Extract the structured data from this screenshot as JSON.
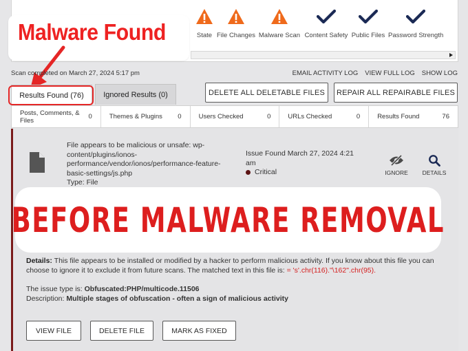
{
  "scan_stages": [
    {
      "label": "State",
      "status": "warning"
    },
    {
      "label": "File Changes",
      "status": "warning"
    },
    {
      "label": "Malware Scan",
      "status": "warning"
    },
    {
      "label": "Content Safety",
      "status": "ok"
    },
    {
      "label": "Public Files",
      "status": "ok"
    },
    {
      "label": "Password Strength",
      "status": "ok"
    }
  ],
  "callout": {
    "text": "Malware Found"
  },
  "scan_complete_text": "Scan completed on March 27, 2024 5:17 pm",
  "top_links": {
    "email": "EMAIL ACTIVITY LOG",
    "full": "VIEW FULL LOG",
    "show": "SHOW LOG"
  },
  "tabs": {
    "results": "Results Found (76)",
    "ignored": "Ignored Results (0)"
  },
  "actions": {
    "delete_all": "DELETE ALL DELETABLE FILES",
    "repair_all": "REPAIR ALL REPAIRABLE FILES"
  },
  "stats": [
    {
      "label": "Posts, Comments, & Files",
      "value": "0"
    },
    {
      "label": "Themes & Plugins",
      "value": "0"
    },
    {
      "label": "Users Checked",
      "value": "0"
    },
    {
      "label": "URLs Checked",
      "value": "0"
    },
    {
      "label": "Results Found",
      "value": "76"
    }
  ],
  "issue": {
    "description": "File appears to be malicious or unsafe: wp-content/plugins/ionos-performance/vendor/ionos/performance-feature-basic-settings/js.php",
    "type_line": "Type: File",
    "found": "Issue Found March 27, 2024 4:21 am",
    "severity": "Critical",
    "ignore_label": "IGNORE",
    "details_label": "DETAILS"
  },
  "banner": {
    "text": "BEFORE MALWARE REMOVAL"
  },
  "details": {
    "label": "Details:",
    "text": "This file appears to be installed or modified by a hacker to perform malicious activity. If you know about this file you can choose to ignore it to exclude it from future scans. The matched text in this file is:",
    "match": "= 's'.chr(116).\"\\162\".chr(95).",
    "issue_type_label": "The issue type is:",
    "issue_type": "Obfuscated:PHP/multicode.11506",
    "description_label": "Description:",
    "description": "Multiple stages of obfuscation - often a sign of malicious activity"
  },
  "card_buttons": {
    "view": "VIEW FILE",
    "delete": "DELETE FILE",
    "fixed": "MARK AS FIXED"
  },
  "colors": {
    "warning": "#ef6a1b",
    "ok": "#1b2a55",
    "alert": "#e52626",
    "critical": "#5c1414"
  }
}
